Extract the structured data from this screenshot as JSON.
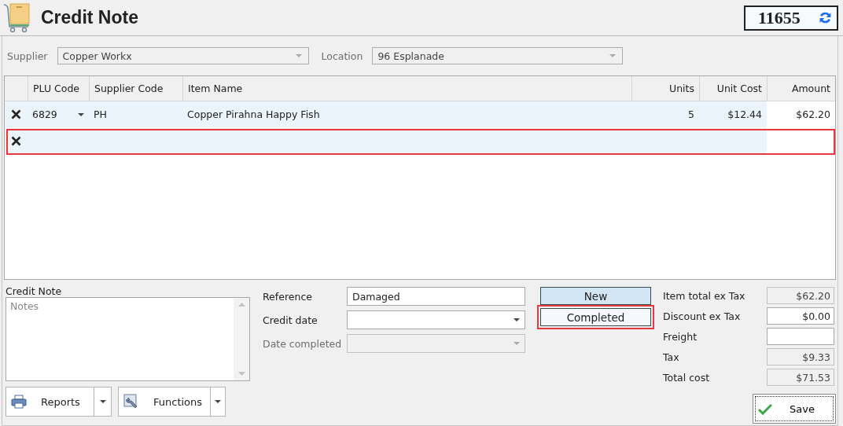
{
  "header": {
    "title": "Credit Note",
    "number": "11655"
  },
  "filters": [
    {
      "label": "Supplier",
      "value": "Copper Workx"
    },
    {
      "label": "Location",
      "value": "96 Esplanade"
    }
  ],
  "table": {
    "columns": [
      "PLU Code",
      "Supplier Code",
      "Item Name",
      "Units",
      "Unit Cost",
      "Amount"
    ],
    "rows": [
      {
        "cells": [
          "6829",
          "PH",
          "Copper Pirahna Happy Fish",
          "5",
          "$12.44",
          "$62.20"
        ],
        "highlighted": false
      },
      {
        "highlighted": true
      }
    ]
  },
  "notes": {
    "label": "Credit Note",
    "placeholder": "Notes"
  },
  "details": [
    {
      "label": "Reference",
      "kind": "text",
      "value": "Damaged",
      "disabled": false
    },
    {
      "label": "Credit date",
      "kind": "dropdown",
      "disabled": false
    },
    {
      "label": "Date completed",
      "kind": "dropdown",
      "disabled": true
    }
  ],
  "status": [
    {
      "label": "New",
      "selected": true,
      "highlighted": false
    },
    {
      "label": "Completed",
      "selected": false,
      "highlighted": true
    }
  ],
  "totals": [
    {
      "label": "Item total ex Tax",
      "value": "$62.20",
      "disabled": true
    },
    {
      "label": "Discount ex Tax",
      "value": "$0.00",
      "disabled": false
    },
    {
      "label": "Freight",
      "disabled": false
    },
    {
      "label": "Tax",
      "value": "$9.33",
      "disabled": true
    },
    {
      "label": "Total cost",
      "value": "$71.53",
      "disabled": true
    }
  ],
  "actions": [
    {
      "label": "Reports"
    },
    {
      "label": "Functions"
    }
  ],
  "save_button": {
    "label": "Save"
  }
}
